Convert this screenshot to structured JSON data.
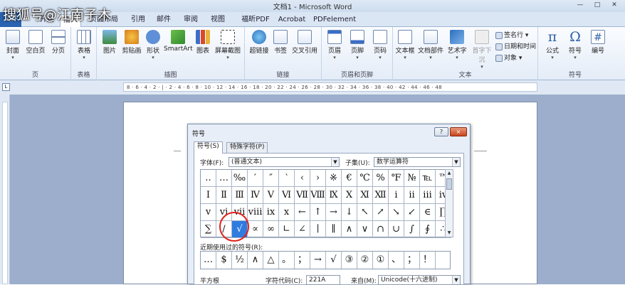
{
  "watermark": "搜狐号@江南子木",
  "window": {
    "title": "文档1 - Microsoft Word",
    "controls": [
      "minimize-icon",
      "maximize-icon",
      "close-icon"
    ]
  },
  "tabs": [
    {
      "label": "文件"
    },
    {
      "label": "开始"
    },
    {
      "label": "插入",
      "active": true
    },
    {
      "label": "页面布局"
    },
    {
      "label": "引用"
    },
    {
      "label": "邮件"
    },
    {
      "label": "审阅"
    },
    {
      "label": "视图"
    },
    {
      "label": "福昕PDF"
    },
    {
      "label": "Acrobat"
    },
    {
      "label": "PDFelement"
    }
  ],
  "ribbon": {
    "groups": [
      {
        "label": "页",
        "buttons": [
          "封面",
          "空白页",
          "分页"
        ]
      },
      {
        "label": "表格",
        "buttons": [
          "表格"
        ]
      },
      {
        "label": "插图",
        "buttons": [
          "图片",
          "剪贴画",
          "形状",
          "SmartArt",
          "图表",
          "屏幕截图"
        ]
      },
      {
        "label": "链接",
        "buttons": [
          "超链接",
          "书签",
          "交叉引用"
        ]
      },
      {
        "label": "页眉和页脚",
        "buttons": [
          "页眉",
          "页脚",
          "页码"
        ]
      },
      {
        "label": "文本",
        "buttons": [
          "文本框",
          "文档部件",
          "艺术字",
          "首字下沉"
        ],
        "small": [
          "签名行",
          "日期和时间",
          "对象"
        ]
      },
      {
        "label": "符号",
        "buttons": [
          "公式",
          "符号",
          "编号"
        ]
      }
    ]
  },
  "ruler": {
    "numbers": "8 · 6 · 4 · 2 · | · 2 · 4 · 6 · 8 · 10 · 12 · 14 · 16 · 18 · 20 · 22 · 24 · 26 · 28 · 30 · 32 · 34 · 36 · 38 · 40 · 42 · 44 · 46 · 48"
  },
  "dialog": {
    "title": "符号",
    "help": "?",
    "close": "×",
    "tabs": [
      "符号(S)",
      "特殊字符(P)"
    ],
    "font_label": "字体(F):",
    "font_value": "(普通文本)",
    "subset_label": "子集(U):",
    "subset_value": "数学运算符",
    "grid": [
      [
        "‥",
        "…",
        "‰",
        "′",
        "″",
        "‵",
        "‹",
        "›",
        "※",
        "€",
        "℃",
        "%",
        "℉",
        "№",
        "℡",
        "™"
      ],
      [
        "Ⅰ",
        "Ⅱ",
        "Ⅲ",
        "Ⅳ",
        "Ⅴ",
        "Ⅵ",
        "Ⅶ",
        "Ⅷ",
        "Ⅸ",
        "Ⅹ",
        "Ⅺ",
        "Ⅻ",
        "ⅰ",
        "ⅱ",
        "ⅲ",
        "ⅳ"
      ],
      [
        "ⅴ",
        "ⅵ",
        "ⅶ",
        "ⅷ",
        "ⅸ",
        "ⅹ",
        "←",
        "↑",
        "→",
        "↓",
        "↖",
        "↗",
        "↘",
        "↙",
        "∈",
        "∏"
      ],
      [
        "∑",
        "∕",
        "√",
        "∝",
        "∞",
        "∟",
        "∠",
        "∣",
        "∥",
        "∧",
        "∨",
        "∩",
        "∪",
        "∫",
        "∮",
        "∴"
      ]
    ],
    "selected_symbol": "√",
    "recent_label": "近期使用过的符号(R):",
    "recent": [
      "…",
      "$",
      "½",
      "∧",
      "△",
      "。",
      "；",
      "→",
      "√",
      "③",
      "②",
      "①",
      "、",
      "；",
      "！"
    ],
    "char_name": "平方根",
    "char_code_label": "字符代码(C):",
    "char_code_value": "221A",
    "from_label": "来自(M):",
    "from_value": "Unicode(十六进制)"
  },
  "colors": {
    "accent": "#2a63b1",
    "selection": "#2f7be0",
    "highlight_circle": "#e0201a"
  }
}
